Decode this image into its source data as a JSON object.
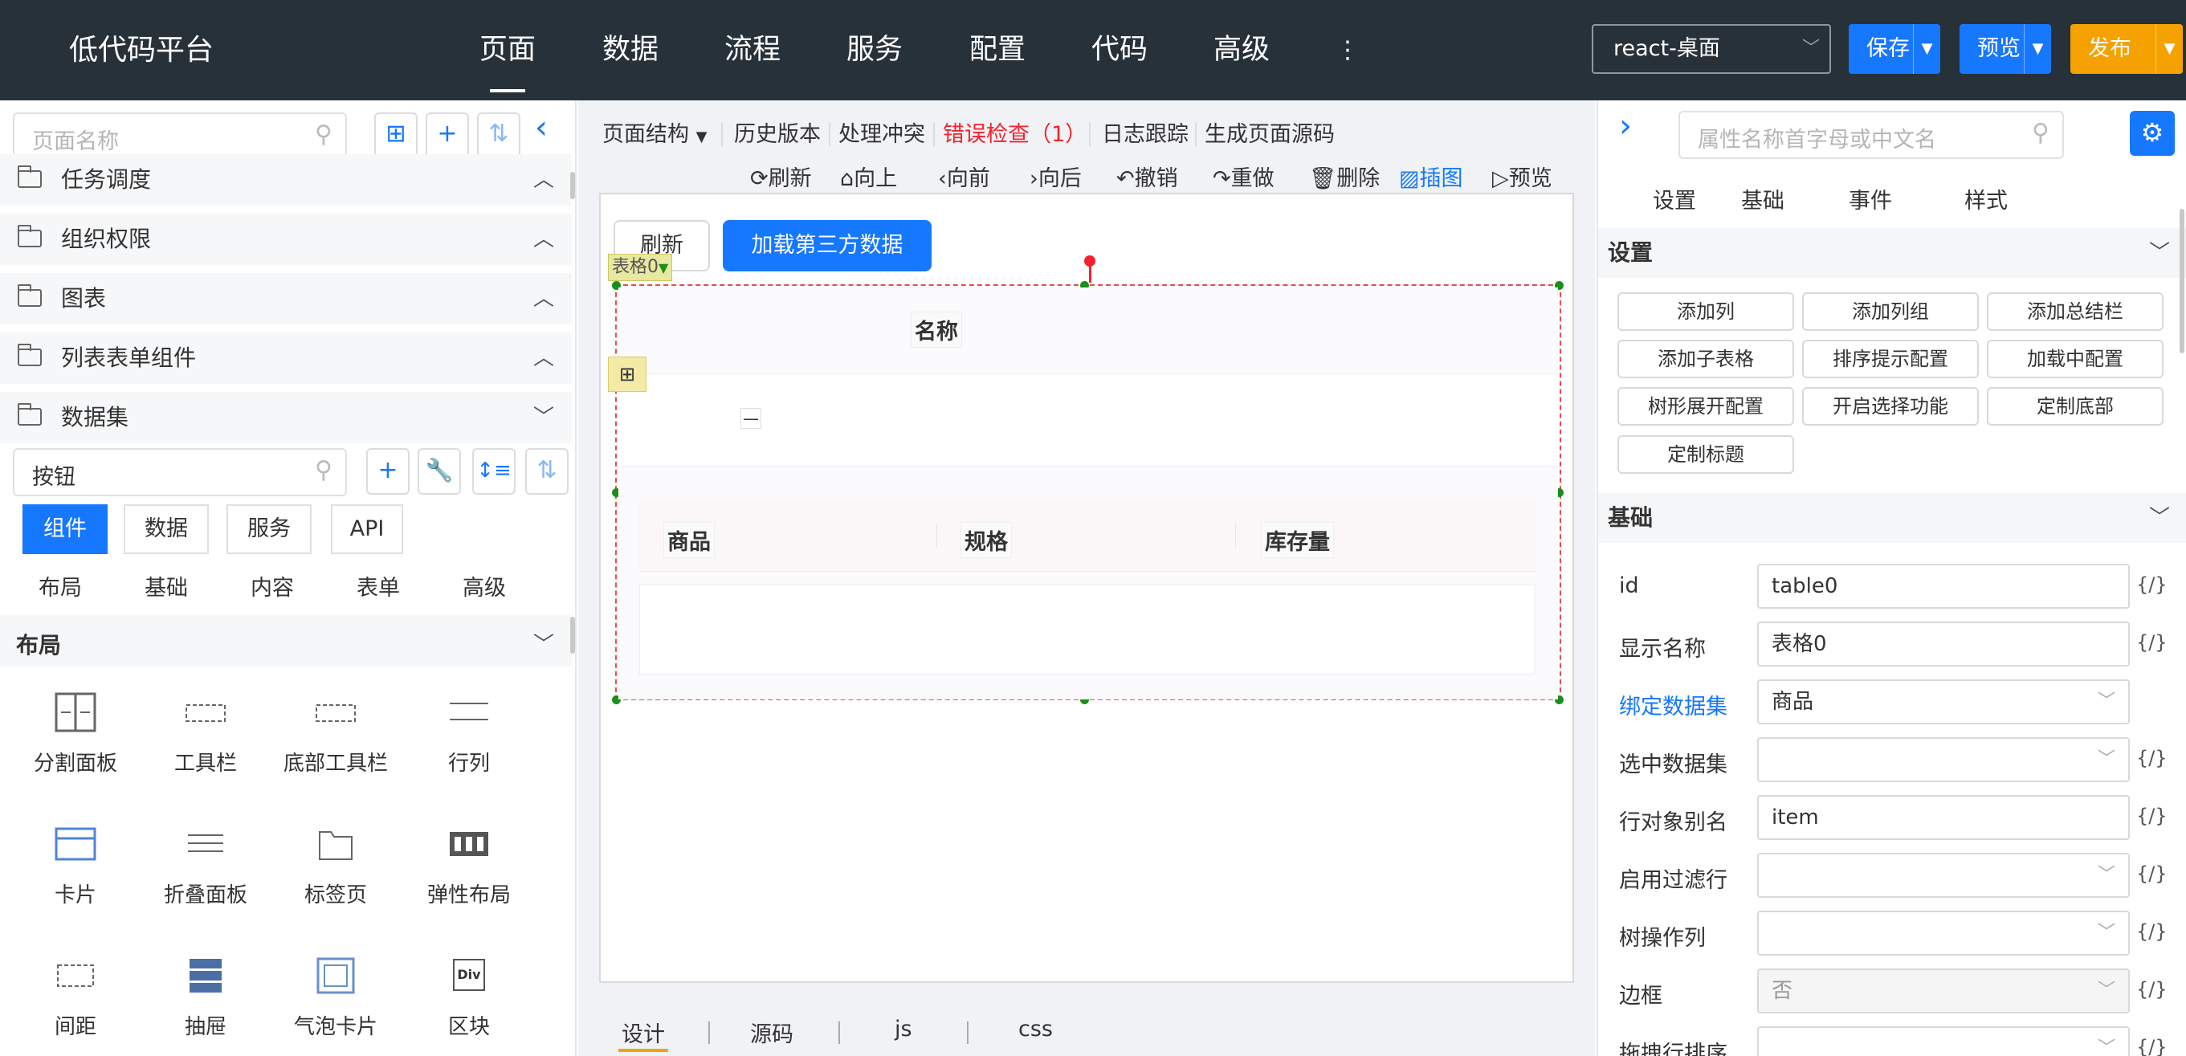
{
  "header": {
    "app_title": "低代码平台",
    "nav": [
      "页面",
      "数据",
      "流程",
      "服务",
      "配置",
      "代码",
      "高级"
    ],
    "nav_more": "⋮",
    "env_select": "react-桌面",
    "save": "保存",
    "preview": "预览",
    "publish": "发布",
    "colors": {
      "bg": "#273139",
      "save": "#1677ff",
      "preview": "#1677ff",
      "publish": "#f5a200"
    }
  },
  "left": {
    "search_placeholder": "页面名称",
    "tree": [
      {
        "label": "任务调度",
        "arrow": "︿"
      },
      {
        "label": "组织权限",
        "arrow": "︿"
      },
      {
        "label": "图表",
        "arrow": "︿"
      },
      {
        "label": "列表表单组件",
        "arrow": "︿"
      },
      {
        "label": "数据集",
        "arrow": "﹀"
      }
    ],
    "comp_search_value": "按钮",
    "tabs": [
      "组件",
      "数据",
      "服务",
      "API"
    ],
    "subcats": [
      "布局",
      "基础",
      "内容",
      "表单",
      "高级"
    ],
    "section_title": "布局",
    "components": [
      "分割面板",
      "工具栏",
      "底部工具栏",
      "行列",
      "卡片",
      "折叠面板",
      "标签页",
      "弹性布局",
      "间距",
      "抽屉",
      "气泡卡片",
      "区块"
    ],
    "block_icon_text": "Div"
  },
  "center": {
    "toolbar": [
      "页面结构",
      "历史版本",
      "处理冲突",
      "错误检查（1）",
      "日志跟踪",
      "生成页面源码"
    ],
    "actions": [
      "刷新",
      "向上",
      "向前",
      "向后",
      "撤销",
      "重做",
      "删除",
      "插图",
      "预览"
    ],
    "canvas": {
      "btn_refresh": "刷新",
      "btn_load": "加载第三方数据",
      "selection_tag": "表格0",
      "table_header": "名称",
      "row_dash": "—",
      "sub_headers": [
        "商品",
        "规格",
        "库存量"
      ]
    },
    "bottom_tabs": [
      "设计",
      "源码",
      "js",
      "css"
    ]
  },
  "right": {
    "search_placeholder": "属性名称首字母或中文名",
    "tabs": [
      "设置",
      "基础",
      "事件",
      "样式"
    ],
    "settings_title": "设置",
    "settings_buttons": [
      "添加列",
      "添加列组",
      "添加总结栏",
      "添加子表格",
      "排序提示配置",
      "加载中配置",
      "树形展开配置",
      "开启选择功能",
      "定制底部",
      "定制标题"
    ],
    "basic_title": "基础",
    "code_marker": "{/}",
    "props": [
      {
        "label": "id",
        "value": "table0"
      },
      {
        "label": "显示名称",
        "value": "表格0"
      },
      {
        "label": "绑定数据集",
        "value": "商品"
      },
      {
        "label": "选中数据集",
        "value": ""
      },
      {
        "label": "行对象别名",
        "value": "item"
      },
      {
        "label": "启用过滤行",
        "value": ""
      },
      {
        "label": "树操作列",
        "value": ""
      },
      {
        "label": "边框",
        "value": "否"
      },
      {
        "label": "拖拽行排序",
        "value": ""
      }
    ]
  }
}
